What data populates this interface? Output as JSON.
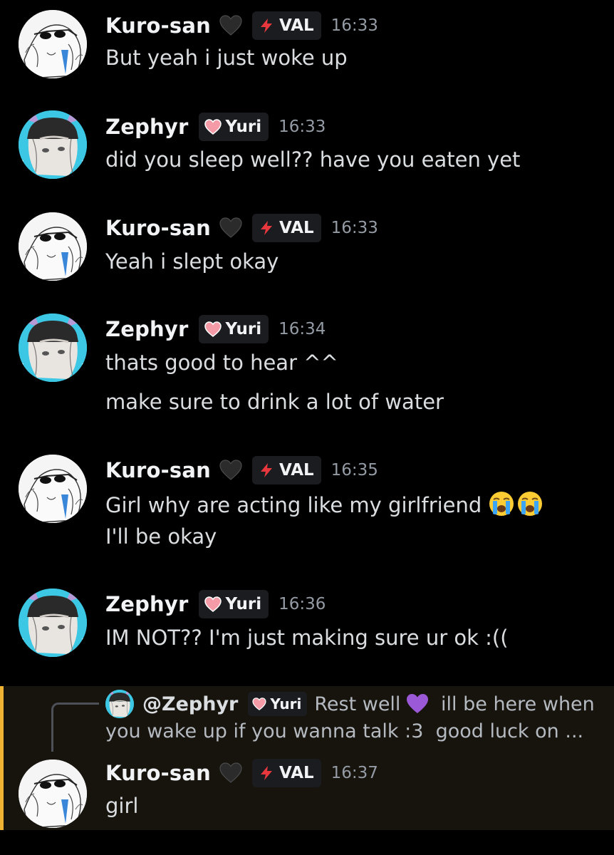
{
  "users": {
    "kuro": {
      "name": "Kuro-san",
      "tag": "VAL",
      "tag_icon": "lightning-icon",
      "badge_icon": "black-heart-icon"
    },
    "zephyr": {
      "name": "Zephyr",
      "tag": "Yuri",
      "tag_icon": "pink-heart-icon"
    }
  },
  "messages": [
    {
      "author": "Kuro-san",
      "tag": "VAL",
      "time": "16:33",
      "lines": [
        "But yeah i just woke up"
      ]
    },
    {
      "author": "Zephyr",
      "tag": "Yuri",
      "time": "16:33",
      "lines": [
        "did you sleep well?? have you eaten yet"
      ]
    },
    {
      "author": "Kuro-san",
      "tag": "VAL",
      "time": "16:33",
      "lines": [
        "Yeah i slept okay"
      ]
    },
    {
      "author": "Zephyr",
      "tag": "Yuri",
      "time": "16:34",
      "lines": [
        "thats good to hear ^^",
        "make sure to drink a lot of water"
      ]
    },
    {
      "author": "Kuro-san",
      "tag": "VAL",
      "time": "16:35",
      "lines": [
        "Girl why are acting like my girlfriend",
        "I'll be okay"
      ],
      "emojis": [
        "loudly-crying-face",
        "loudly-crying-face"
      ]
    },
    {
      "author": "Zephyr",
      "tag": "Yuri",
      "time": "16:36",
      "lines": [
        "IM NOT?? I'm just making sure ur ok :(("
      ]
    },
    {
      "author": "Kuro-san",
      "tag": "VAL",
      "time": "16:37",
      "lines": [
        "girl"
      ],
      "reply_to": {
        "mention": "@Zephyr",
        "tag": "Yuri",
        "text_before_emoji": "Rest well",
        "emoji": "purple-heart",
        "text_after_emoji": " ill be here when",
        "text_line2": "you wake up if you wanna talk :3  good luck on ..."
      }
    }
  ],
  "colors": {
    "background": "#000000",
    "reply_highlight": "#17140e",
    "reply_bar": "#f0b232",
    "time": "#949ba4"
  }
}
